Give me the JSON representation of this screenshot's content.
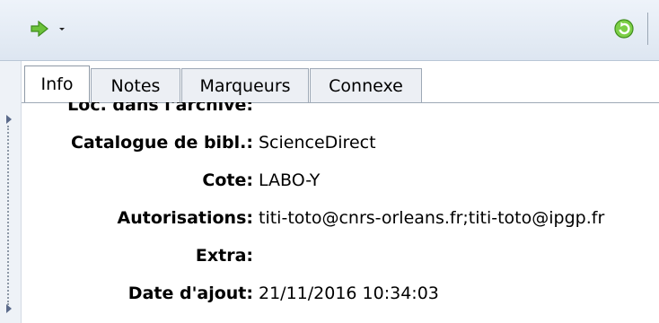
{
  "toolbar": {
    "locate_icon": "green-arrow-icon",
    "dropdown_icon": "chevron-down-icon",
    "refresh_icon": "refresh-icon"
  },
  "tabs": [
    {
      "label": "Info",
      "active": true
    },
    {
      "label": "Notes",
      "active": false
    },
    {
      "label": "Marqueurs",
      "active": false
    },
    {
      "label": "Connexe",
      "active": false
    }
  ],
  "fields": [
    {
      "label": "Loc. dans l'archive:",
      "value": ""
    },
    {
      "label": "Catalogue de bibl.:",
      "value": "ScienceDirect"
    },
    {
      "label": "Cote:",
      "value": "LABO-Y"
    },
    {
      "label": "Autorisations:",
      "value": "titi-toto@cnrs-orleans.fr;titi-toto@ipgp.fr"
    },
    {
      "label": "Extra:",
      "value": ""
    },
    {
      "label": "Date d'ajout:",
      "value": "21/11/2016 10:34:03"
    }
  ],
  "colors": {
    "accent_green": "#5bb630",
    "toolbar_bg": "#e3eaf4",
    "tab_border": "#9ea9b6"
  }
}
